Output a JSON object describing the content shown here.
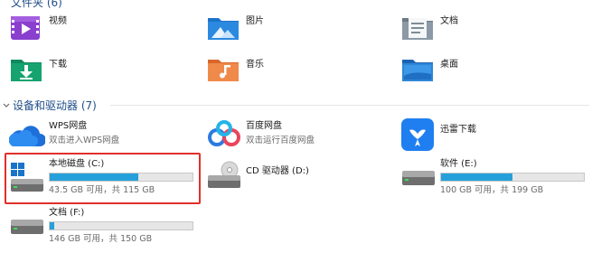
{
  "folders_header": {
    "label": "文件夹 (6)"
  },
  "folders": [
    {
      "label": "视频",
      "icon": "videos-folder-icon"
    },
    {
      "label": "图片",
      "icon": "pictures-folder-icon"
    },
    {
      "label": "文档",
      "icon": "documents-folder-icon"
    },
    {
      "label": "下载",
      "icon": "downloads-folder-icon"
    },
    {
      "label": "音乐",
      "icon": "music-folder-icon"
    },
    {
      "label": "桌面",
      "icon": "desktop-folder-icon"
    }
  ],
  "devices_header": {
    "label": "设备和驱动器 (7)"
  },
  "devices": [
    {
      "label": "WPS网盘",
      "sub": "双击进入WPS网盘",
      "icon": "wps-cloud-icon"
    },
    {
      "label": "百度网盘",
      "sub": "双击运行百度网盘",
      "icon": "baidu-netdisk-icon"
    },
    {
      "label": "迅雷下载",
      "icon": "xunlei-icon"
    }
  ],
  "drives": [
    {
      "label": "本地磁盘 (C:)",
      "space": "43.5 GB 可用，共 115 GB",
      "used_fraction": 0.62,
      "icon": "windows-drive-icon"
    },
    {
      "label": "CD 驱动器 (D:)",
      "icon": "cd-drive-icon"
    },
    {
      "label": "软件 (E:)",
      "space": "100 GB 可用，共 199 GB",
      "used_fraction": 0.5,
      "icon": "hard-drive-icon"
    },
    {
      "label": "文档 (F:)",
      "space": "146 GB 可用，共 150 GB",
      "used_fraction": 0.03,
      "icon": "hard-drive-icon"
    }
  ],
  "colors": {
    "accent": "#26a0da",
    "selection": "#e0302a",
    "header": "#1f4e8a"
  }
}
